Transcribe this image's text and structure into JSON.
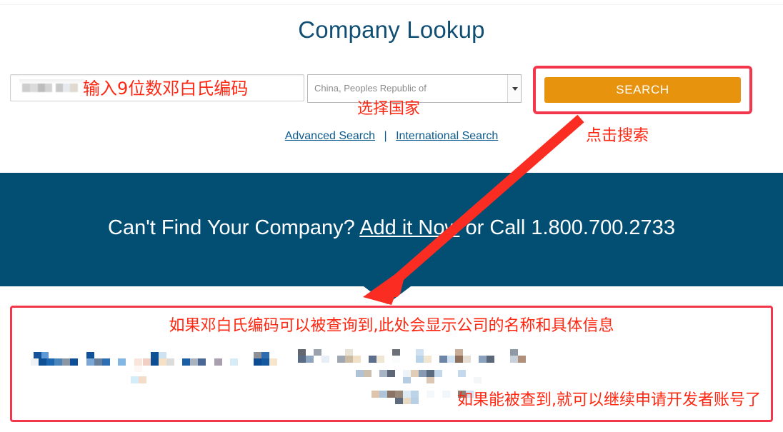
{
  "page": {
    "title": "Company Lookup",
    "title_color": "#104f73"
  },
  "search": {
    "duns_input": {
      "value": "",
      "placeholder": "",
      "redacted": true
    },
    "country_select": {
      "selected": "China, Peoples Republic of",
      "arrow_icon": "chevron-down-icon"
    },
    "search_button": {
      "label": "SEARCH",
      "color": "#e8930d"
    },
    "links": {
      "advanced": "Advanced Search",
      "separator": "|",
      "international": "International Search"
    }
  },
  "annotations": {
    "color": "#fe2712",
    "highlight_color": "#f2364c",
    "duns_hint": "输入9位数邓白氏编码",
    "country_hint": "选择国家",
    "click_search_hint": "点击搜索",
    "results_hint": "如果邓白氏编码可以被查询到,此处会显示公司的名称和具体信息",
    "results_footnote": "如果能被查到,就可以继续申请开发者账号了"
  },
  "banner": {
    "background": "#034f74",
    "prefix": "Can't Find Your Company? ",
    "link": "Add it Now",
    "middle": " or Call ",
    "phone": "1.800.700.2733"
  },
  "results": {
    "redacted": true,
    "note": "company name and details are pixelated / obscured"
  }
}
